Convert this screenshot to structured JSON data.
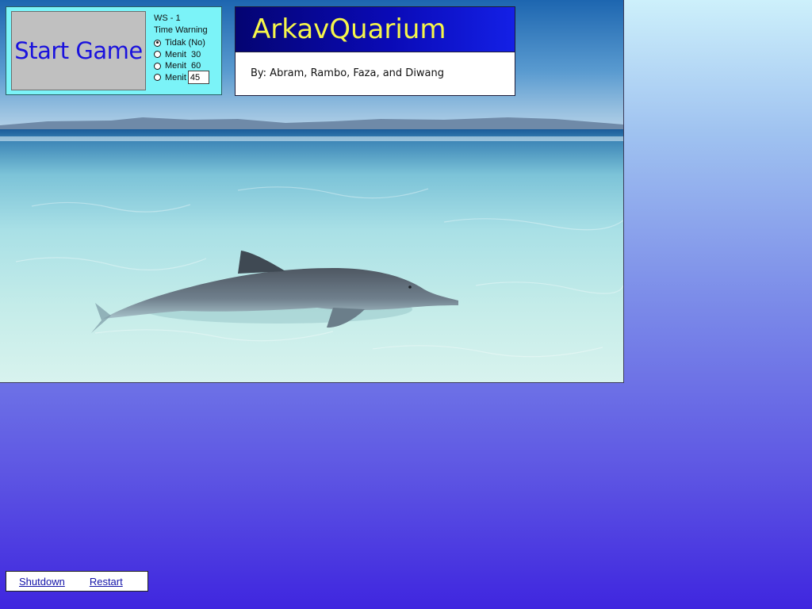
{
  "start_panel": {
    "button_label": "Start Game",
    "workstation": "WS - 1",
    "time_warning_label": "Time Warning",
    "options": [
      {
        "label": "Tidak (No)",
        "checked": true
      },
      {
        "label": "Menit  30",
        "checked": false
      },
      {
        "label": "Menit  60",
        "checked": false
      },
      {
        "label": "Menit",
        "checked": false,
        "input_value": "45"
      }
    ]
  },
  "title_panel": {
    "title": "ArkavQuarium",
    "credits": "By: Abram, Rambo, Faza, and Diwang"
  },
  "bottom_links": {
    "shutdown": "Shutdown",
    "restart": "Restart"
  },
  "colors": {
    "panel_background": "#7bf3f8",
    "title_text": "#f6f64a",
    "title_bar": "#0a0ab6",
    "start_label": "#1a12dd",
    "link": "#1212a8"
  },
  "icons": {
    "radio_checked": "filled-circle",
    "radio_unchecked": "empty-circle"
  },
  "scene": {
    "subject": "dolphin-in-shallow-sea"
  }
}
